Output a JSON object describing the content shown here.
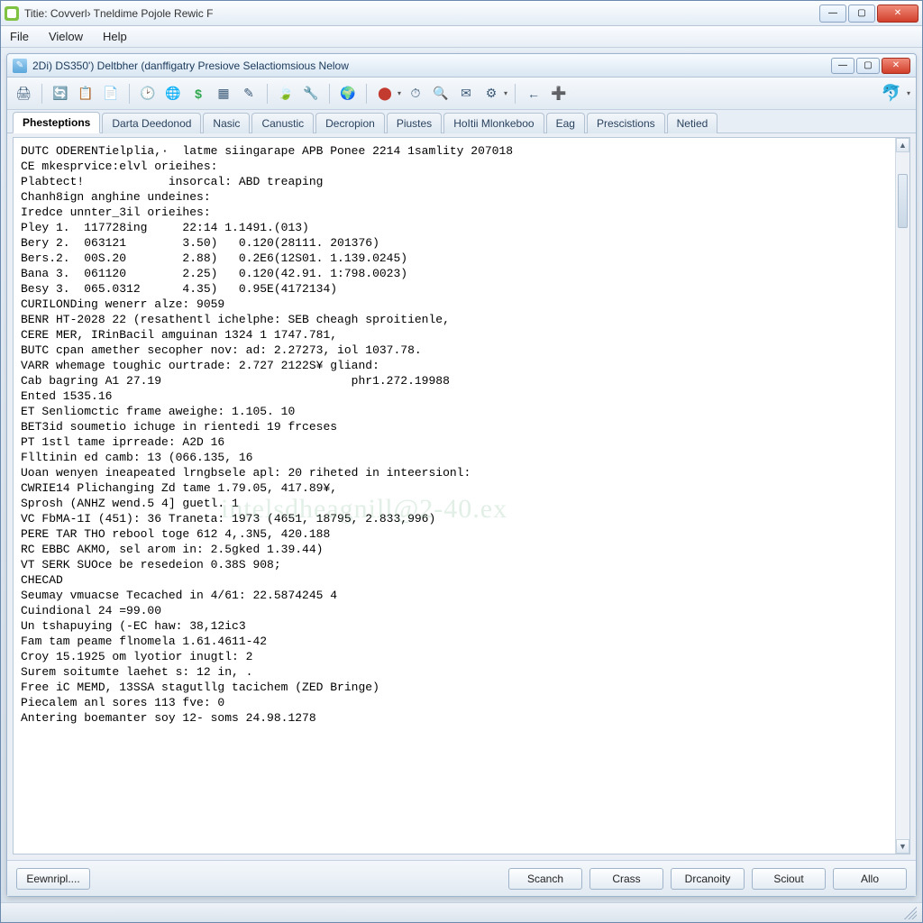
{
  "outer": {
    "title": "Titie: Covverl› Tneldime Pojole Rewic F"
  },
  "menu": {
    "file": "File",
    "view": "Vielow",
    "help": "Help"
  },
  "inner": {
    "title": "2Di) DS350') Deltbher (danffigatry Presiove Selactiomsious Nelow"
  },
  "tabs": [
    "Phesteptions",
    "Darta Deedonod",
    "Nasic",
    "Canustic",
    "Decropion",
    "Piustes",
    "HoItii Mlonkeboo",
    "Eag",
    "Prescistions",
    "Netied"
  ],
  "active_tab_index": 0,
  "console_lines": [
    "DUTC ODERENTielplia,·  latme siingarape APB Ponee 2214 1samlity 207018",
    "CE mkesprvice:elvl orieihes:",
    "Plabtect!            insorcal: ABD treaping",
    "Chanh8ign anghine undeines:",
    "Iredce unnter_3il orieihes:",
    "Pley 1.  117728ing     22:14 1.1491.(013)",
    "Bery 2.  063121        3.50)   0.120(28111. 201376)",
    "Bers.2.  00S.20        2.88)   0.2E6(12S01. 1.139.0245)",
    "Bana 3.  061120        2.25)   0.120(42.91. 1:798.0023)",
    "Besy 3.  065.0312      4.35)   0.95E(4172134)",
    "CURILONDing wenerr alze: 9059",
    "BENR HT-2028 22 (resathentl ichelphe: SEB cheagh sproitienle,",
    "CERE MER, IRinBacil amguinan 1324 1 1747.781,",
    "BUTC cpan amether secopher nov: ad: 2.27273, iol 1037.78.",
    "VARR whemage toughic ourtrade: 2.727 2122S¥ gliand:",
    "Cab bagring A1 27.19                           phr1.272.19988",
    "Ented 1535.16",
    "ET Senliomctic frame aweighe: 1.105. 10",
    "BET3id soumetio ichuge in rientedi 19 frceses",
    "PT 1stl tame iprreade: A2D 16",
    "Flltinin ed camb: 13 (066.135, 16",
    "Uoan wenyen ineapeated lrngbsele apl: 20 riheted in inteersionl:",
    "CWRIE14 Plichanging Zd tame 1.79.05, 417.89¥,",
    "Sprosh (ANHZ wend.5 4] guetl. 1",
    "VC FbMA-1I (451): 36 Traneta: 1973 (4651, 18795, 2.833,996)",
    "PERE TAR THO rebool toge 612 4,.3N5, 420.188",
    "RC EBBC AKMO, sel arom in: 2.5gked 1.39.44)",
    "VT SERK SUOce be resedeion 0.38S 908;",
    "CHECAD",
    "Seumay vmuacse Tecached in 4/61: 22.5874245 4",
    "Cuindional 24 =99.00",
    "Un tshapuying (-EC haw: 38,12ic3",
    "Fam tam peame flnomela 1.61.4611-42",
    "Croy 15.1925 om lyotior inugtl: 2",
    "Surem soitumte laehet s: 12 in, .",
    "Free iC MEMD, 13SSA stagutllg tacichem (ZED Bringe)",
    "Piecalem anl sores 113 fve: 0",
    "Antering boemanter soy 12- soms 24.98.1278"
  ],
  "buttons": {
    "export": "Eewnripl....",
    "search": "Scanch",
    "crass": "Crass",
    "drcanoity": "Drcanoity",
    "sciout": "Sciout",
    "allo": "Allo"
  },
  "icons": {
    "print": "🖨",
    "refresh": "🔄",
    "copy": "📋",
    "paste": "📄",
    "clock": "🕑",
    "globe": "🌐",
    "dollar": "$",
    "grid": "▦",
    "edit": "✎",
    "leaf": "🍃",
    "wrench": "🔧",
    "world": "🌍",
    "rec": "⬤",
    "stop": "⏱",
    "zoom": "🔍",
    "mail": "✉",
    "gear": "⚙",
    "sep": "|",
    "back": "←",
    "tab_new": "➕",
    "dolphin": "🐬",
    "caret": "▾",
    "minimize": "—",
    "maximize": "▢",
    "close": "✕",
    "scroll_up": "▲",
    "scroll_down": "▼"
  },
  "watermark": "intelsdheagnill@2-40.ex"
}
